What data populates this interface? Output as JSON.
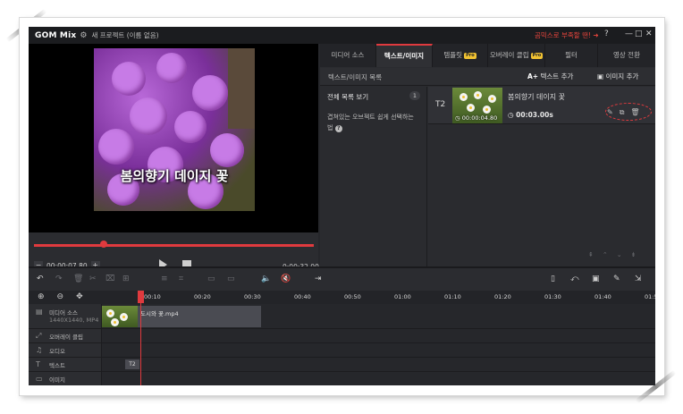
{
  "app": {
    "logo": "GOM Mix",
    "project_title": "새 프로젝트 (이름 없음)",
    "promo": "곰믹스로 부족할 땐! ➜",
    "help": "?",
    "min": "—",
    "max": "□",
    "close": "✕"
  },
  "preview": {
    "caption": "봄의향기 데이지 꽃",
    "current_time": "00:00:07.80",
    "duration": "0:00:32.00",
    "minus": "−",
    "plus": "+"
  },
  "tabs": [
    {
      "label": "미디어 소스",
      "pro": ""
    },
    {
      "label": "텍스트/이미지",
      "pro": ""
    },
    {
      "label": "템플릿",
      "pro": "Pro"
    },
    {
      "label": "오버레이 클립",
      "pro": "Pro"
    },
    {
      "label": "필터",
      "pro": ""
    },
    {
      "label": "영상 전환",
      "pro": ""
    }
  ],
  "panel": {
    "subtitle": "텍스트/이미지 목록",
    "add_text": "텍스트 추가",
    "add_image": "이미지 추가",
    "view_all": "전체 목록 보기",
    "count": "1",
    "hint": "겹쳐있는 오브젝트 쉽게 선택하는 법",
    "hint_icon": "?"
  },
  "item": {
    "tag": "T2",
    "title": "봄의향기 데이지 꽃",
    "thumb_time": "00:00:04.80",
    "duration": "00:03.00s"
  },
  "timeline": {
    "ticks": [
      "00:10",
      "00:20",
      "00:30",
      "00:40",
      "00:50",
      "01:00",
      "01:10",
      "01:20",
      "01:30",
      "01:40",
      "01:5"
    ],
    "tracks": [
      {
        "label": "미디어 소스",
        "sub": "1440X1440, MP4"
      },
      {
        "label": "오버레이 클립",
        "sub": ""
      },
      {
        "label": "오디오",
        "sub": ""
      },
      {
        "label": "텍스트",
        "sub": ""
      },
      {
        "label": "이미지",
        "sub": ""
      }
    ],
    "clip_label": "도시와 꽃.mp4",
    "text_chip": "T2"
  }
}
